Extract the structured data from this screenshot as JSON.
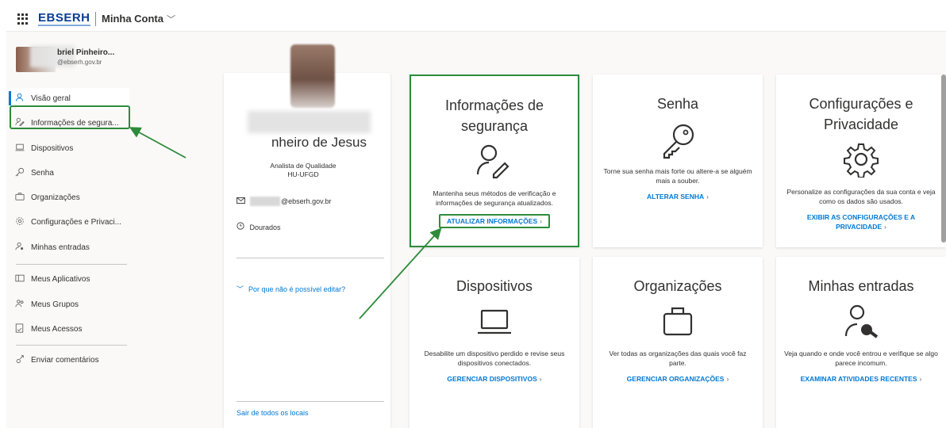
{
  "topbar": {
    "logo": "EBSERH",
    "account": "Minha Conta"
  },
  "user": {
    "name": "briel Pinheiro...",
    "email": "@ebserh.gov.br"
  },
  "nav": {
    "items": [
      {
        "label": "Visão geral",
        "icon": "person-icon"
      },
      {
        "label": "Informações de segura...",
        "icon": "security-info-icon"
      },
      {
        "label": "Dispositivos",
        "icon": "laptop-icon"
      },
      {
        "label": "Senha",
        "icon": "key-icon"
      },
      {
        "label": "Organizações",
        "icon": "briefcase-icon"
      },
      {
        "label": "Configurações e Privaci...",
        "icon": "gear-icon"
      },
      {
        "label": "Minhas entradas",
        "icon": "sign-ins-icon"
      },
      {
        "label": "Meus Aplicativos",
        "icon": "apps-icon"
      },
      {
        "label": "Meus Grupos",
        "icon": "groups-icon"
      },
      {
        "label": "Meus Acessos",
        "icon": "access-icon"
      },
      {
        "label": "Enviar comentários",
        "icon": "feedback-icon"
      }
    ]
  },
  "profile": {
    "name": "nheiro de Jesus",
    "title_line1": "Analista de Qualidade",
    "title_line2": "HU-UFGD",
    "email": "@ebserh.gov.br",
    "location": "Dourados",
    "why_edit": "Por que não é possível editar?",
    "signout": "Sair de todos os locais"
  },
  "tiles": {
    "seguranca": {
      "title": "Informações de segurança",
      "desc": "Mantenha seus métodos de verificação e informações de segurança atualizados.",
      "link": "ATUALIZAR INFORMAÇÕES"
    },
    "senha": {
      "title": "Senha",
      "desc": "Torne sua senha mais forte ou altere-a se alguém mais a souber.",
      "link": "ALTERAR SENHA"
    },
    "privacidade": {
      "title": "Configurações e Privacidade",
      "desc": "Personalize as configurações da sua conta e veja como os dados são usados.",
      "link": "EXIBIR AS CONFIGURAÇÕES E A PRIVACIDADE"
    },
    "dispositivos": {
      "title": "Dispositivos",
      "desc": "Desabilite um dispositivo perdido e revise seus dispositivos conectados.",
      "link": "GERENCIAR DISPOSITIVOS"
    },
    "organizacoes": {
      "title": "Organizações",
      "desc": "Ver todas as organizações das quais você faz parte.",
      "link": "GERENCIAR ORGANIZAÇÕES"
    },
    "entradas": {
      "title": "Minhas entradas",
      "desc": "Veja quando e onde você entrou e verifique se algo parece incomum.",
      "link": "EXAMINAR ATIVIDADES RECENTES"
    }
  },
  "colors": {
    "accent": "#0078d4",
    "highlight": "#2e8b3a"
  }
}
